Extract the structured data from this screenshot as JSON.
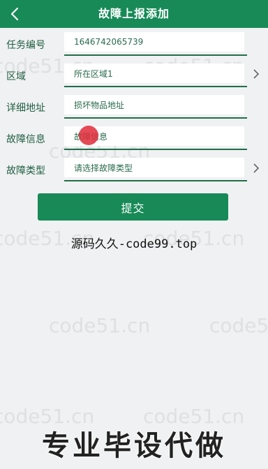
{
  "header": {
    "title": "故障上报添加",
    "back_icon": "chevron-left-icon"
  },
  "form": {
    "fields": [
      {
        "label": "任务编号",
        "value": "1646742065739",
        "has_arrow": false
      },
      {
        "label": "区域",
        "value": "所在区域1",
        "has_arrow": true
      },
      {
        "label": "详细地址",
        "value": "损坏物品地址",
        "has_arrow": false
      },
      {
        "label": "故障信息",
        "value": "故障信息",
        "has_arrow": false
      },
      {
        "label": "故障类型",
        "value": "请选择故障类型",
        "has_arrow": true
      }
    ]
  },
  "submit_label": "提交",
  "caption": "源码久久-code99.top",
  "watermark": "code51.cn",
  "bottom_banner": "专业毕设代做",
  "colors": {
    "primary": "#178a57",
    "background": "#f0f1f2",
    "touch_indicator": "#e02a3a"
  }
}
